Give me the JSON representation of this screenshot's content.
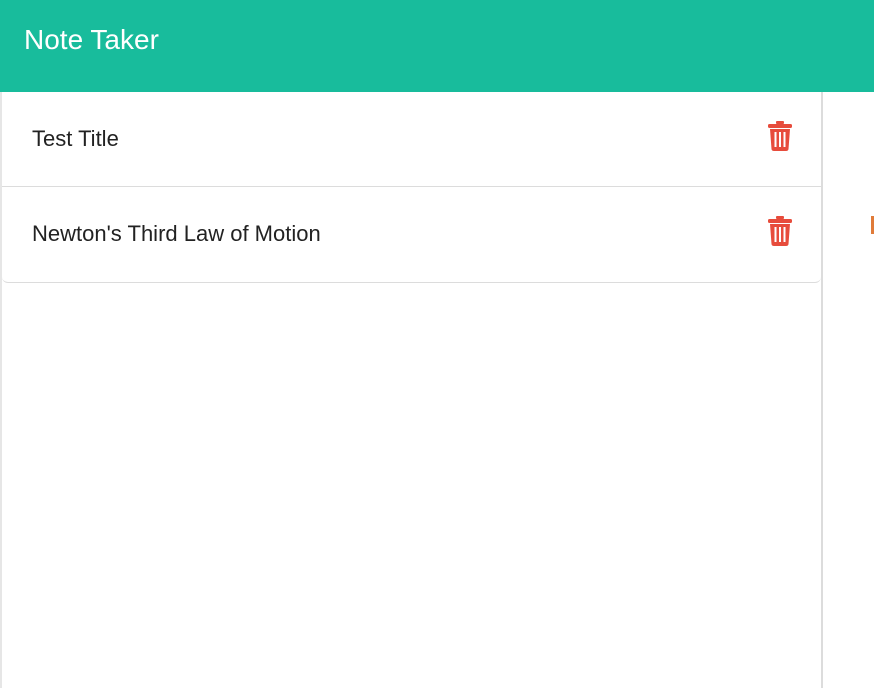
{
  "navbar": {
    "title": "Note Taker"
  },
  "notes": {
    "items": [
      {
        "title": "Test Title",
        "icon": "trash-icon"
      },
      {
        "title": "Newton's Third Law of Motion",
        "icon": "trash-icon"
      }
    ]
  },
  "colors": {
    "navbar_bg": "#18bc9c",
    "delete_icon": "#e74c3c"
  }
}
